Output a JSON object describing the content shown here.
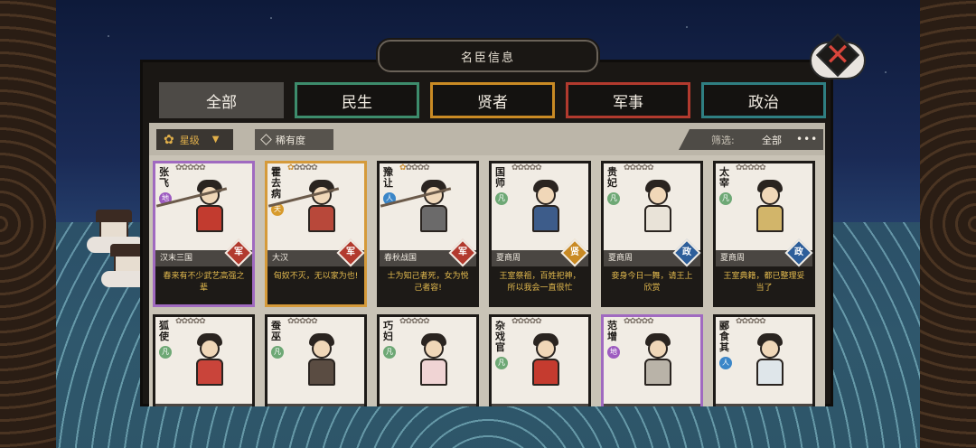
{
  "window": {
    "title": "名臣信息",
    "close_label": "✕"
  },
  "tabs": [
    {
      "label": "全部",
      "active": true,
      "color": "#4d4a46"
    },
    {
      "label": "民生",
      "active": false,
      "color": "#3d8c6c"
    },
    {
      "label": "贤者",
      "active": false,
      "color": "#c98a24"
    },
    {
      "label": "军事",
      "active": false,
      "color": "#b23a2e"
    },
    {
      "label": "政治",
      "active": false,
      "color": "#2f7f82"
    }
  ],
  "toolbar": {
    "sort_label": "星级",
    "sort_icon": "flower-icon",
    "rarity_label": "稀有度",
    "filter_label": "筛选:",
    "filter_value": "全部",
    "more_label": "•••"
  },
  "cards": [
    {
      "name": "张飞",
      "tier": "地",
      "stars": 0,
      "era": "汉末三国",
      "type": "军",
      "quote": "春来有不少武艺高强之辈",
      "rarity": "purple"
    },
    {
      "name": "霍去病",
      "tier": "天",
      "stars": 1,
      "era": "大汉",
      "type": "军",
      "quote": "匈奴不灭，无以家为也!",
      "rarity": "gold"
    },
    {
      "name": "豫让",
      "tier": "人",
      "stars": 1,
      "era": "春秋战国",
      "type": "军",
      "quote": "士为知己者死，女为悦己者容!",
      "rarity": "normal"
    },
    {
      "name": "国师",
      "tier": "凡",
      "stars": 0,
      "era": "夏商周",
      "type": "贤",
      "quote": "王室祭祖，百姓祀神，所以我会一直很忙",
      "rarity": "normal"
    },
    {
      "name": "贵妃",
      "tier": "凡",
      "stars": 0,
      "era": "夏商周",
      "type": "政",
      "quote": "妾身今日一舞，请王上欣赏",
      "rarity": "normal"
    },
    {
      "name": "太宰",
      "tier": "凡",
      "stars": 0,
      "era": "夏商周",
      "type": "政",
      "quote": "王室典籍，都已整理妥当了",
      "rarity": "normal"
    },
    {
      "name": "狐使",
      "tier": "凡",
      "stars": 0,
      "era": "",
      "type": "",
      "quote": "",
      "rarity": "normal"
    },
    {
      "name": "蚕巫",
      "tier": "凡",
      "stars": 0,
      "era": "",
      "type": "",
      "quote": "",
      "rarity": "normal"
    },
    {
      "name": "巧妇",
      "tier": "凡",
      "stars": 0,
      "era": "",
      "type": "",
      "quote": "",
      "rarity": "normal"
    },
    {
      "name": "杂戏官",
      "tier": "凡",
      "stars": 0,
      "era": "",
      "type": "",
      "quote": "",
      "rarity": "normal"
    },
    {
      "name": "范增",
      "tier": "地",
      "stars": 0,
      "era": "",
      "type": "",
      "quote": "",
      "rarity": "purple"
    },
    {
      "name": "郦食其",
      "tier": "人",
      "stars": 0,
      "era": "",
      "type": "",
      "quote": "",
      "rarity": "normal"
    }
  ],
  "colors": {
    "panel": "#1a1714",
    "content": "#c9c3b6",
    "quote_text": "#e2b94e",
    "purple": "#a06ac0",
    "gold": "#d59a3a"
  }
}
